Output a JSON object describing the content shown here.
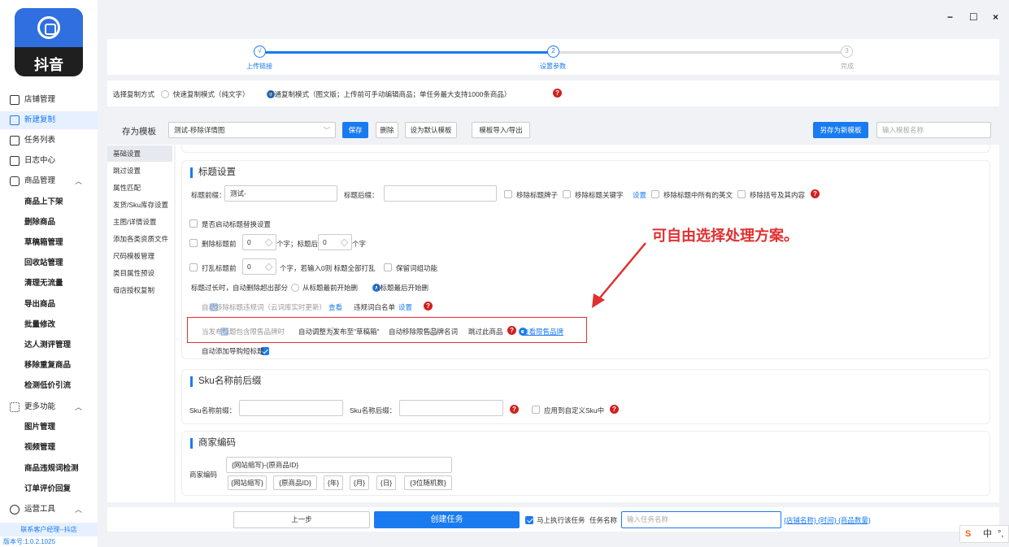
{
  "app": {
    "brand": "抖音",
    "contact": "联系客户经理--抖店",
    "version": "版本号:1.0.2.1025"
  },
  "window": {
    "minimize": "−",
    "maximize": "☐",
    "close": "×"
  },
  "sidebar": {
    "shop": "店铺管理",
    "new_copy": "新建复制",
    "tasks": "任务列表",
    "logs": "日志中心",
    "goods": "商品管理",
    "goods_items": [
      "商品上下架",
      "删除商品",
      "草稿箱管理",
      "回收站管理",
      "清理无流量",
      "导出商品",
      "批量修改",
      "达人测评管理",
      "移除重复商品",
      "检测低价引流"
    ],
    "more": "更多功能",
    "more_items": [
      "图片管理",
      "视频管理",
      "商品违规词检测",
      "订单评价回复"
    ],
    "ops": "运营工具"
  },
  "steps": [
    {
      "num": "√",
      "label": "上传链接"
    },
    {
      "num": "2",
      "label": "设置参数"
    },
    {
      "num": "3",
      "label": "完成"
    }
  ],
  "mode": {
    "label": "选择复制方式",
    "opt1": "快速复制模式（纯文字）",
    "opt2": "普通复制模式（图文版；上传前可手动编辑商品；单任务最大支持1000条商品）"
  },
  "template": {
    "label": "存为模板",
    "selected": "测试-移除详情图",
    "save": "保存",
    "delete": "删除",
    "set_default": "设为默认模板",
    "import_export": "模板导入/导出",
    "save_new": "另存为新模板",
    "name_placeholder": "输入模板名称"
  },
  "menu": [
    "基础设置",
    "跳过设置",
    "属性匹配",
    "发货/Sku库存设置",
    "主图/详情设置",
    "添加各类资质文件",
    "尺码模板管理",
    "类目属性预设",
    "母店授权复制"
  ],
  "title_settings": {
    "heading": "标题设置",
    "prefix_label": "标题前缀：",
    "prefix_value": "测试-",
    "suffix_label": "标题后缀：",
    "remove_brackets": "移除标题牌子",
    "remove_keywords": "移除标题关键字",
    "settings": "设置",
    "remove_english": "移除标题中所有的英文",
    "remove_parens": "移除括号及其内容",
    "enable_replace": "是否启动标题替换设置",
    "delete_front": "删除标题前",
    "front_n": "0",
    "chars_back": "个字；标题后",
    "back_n": "0",
    "chars": "个字",
    "shuffle": "打乱标题前",
    "shuffle_n": "0",
    "shuffle_tail": "个字，若输入0则 标题全部打乱",
    "keep_words": "保留词组功能",
    "too_long": "标题过长时，自动删除超出部分",
    "from_start": "从标题最前开始删",
    "from_end": "从标题最后开始删",
    "auto_remove_banned": "自动移除标题违规词（云词库实时更新）",
    "view": "查看",
    "whitelist": "违规词白名单",
    "settings2": "设置",
    "brand_limit": "当发布标题包含限售品牌时",
    "opt_draft": "自动调整为发布至\"草稿箱\"",
    "opt_remove": "自动移除限售品牌名词",
    "opt_skip": "跳过此商品",
    "view_brands": "查看限售品牌",
    "auto_guide": "自动添加导购短标题"
  },
  "sku": {
    "heading": "Sku名称前后缀",
    "prefix": "Sku名称前缀：",
    "suffix": "Sku名称后缀：",
    "apply_custom": "应用到自定义Sku中"
  },
  "merchant": {
    "heading": "商家编码",
    "label": "商家编码",
    "value": "{网站缩写}-{原商品ID}",
    "tags": [
      "{网站缩写}",
      "{原商品ID}",
      "{年}",
      "{月}",
      "{日}",
      "{3位随机数}"
    ]
  },
  "annotation": "可自由选择处理方案。",
  "bottom": {
    "prev": "上一步",
    "create": "创建任务",
    "run_now": "马上执行该任务",
    "task_name": "任务名称",
    "task_placeholder": "输入任务名称",
    "links": "{店铺名称} {时间} {商品数量}"
  },
  "ime": {
    "logo": "S",
    "lang": "中",
    "punct": "°,"
  }
}
